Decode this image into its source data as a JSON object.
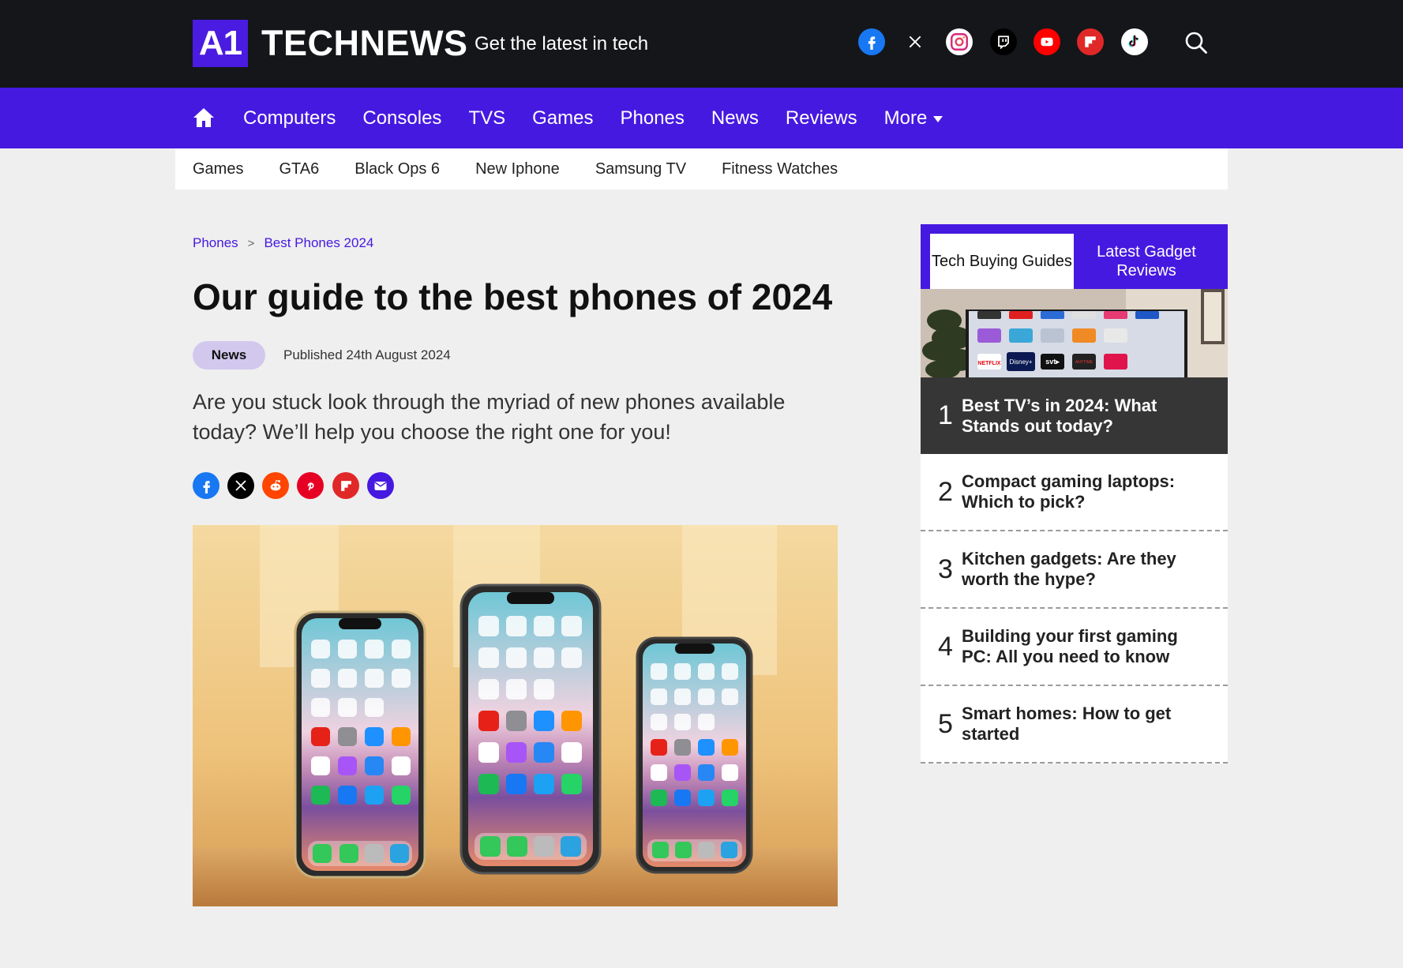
{
  "header": {
    "logo_mark": "A1",
    "logo_text": "TECHNEWS",
    "tagline": "Get the latest in tech",
    "social": [
      {
        "name": "facebook",
        "icon": "facebook-icon",
        "color": "#1877f2"
      },
      {
        "name": "x",
        "icon": "x-icon",
        "color": "#000000"
      },
      {
        "name": "instagram",
        "icon": "instagram-icon",
        "color": "#e4405f"
      },
      {
        "name": "twitch",
        "icon": "twitch-icon",
        "color": "#000000"
      },
      {
        "name": "youtube",
        "icon": "youtube-icon",
        "color": "#ff0000"
      },
      {
        "name": "flipboard",
        "icon": "flipboard-icon",
        "color": "#e12828"
      },
      {
        "name": "tiktok",
        "icon": "tiktok-icon",
        "color": "#000000"
      }
    ],
    "search_icon": "search-icon"
  },
  "nav": {
    "home_icon": "home-icon",
    "items": [
      "Computers",
      "Consoles",
      "TVS",
      "Games",
      "Phones",
      "News",
      "Reviews",
      "More"
    ],
    "accent": "#4619e0"
  },
  "subnav": {
    "items": [
      "Games",
      "GTA6",
      "Black Ops 6",
      "New Iphone",
      "Samsung TV",
      "Fitness Watches"
    ]
  },
  "article": {
    "breadcrumb": [
      "Phones",
      "Best Phones 2024"
    ],
    "breadcrumb_separator": ">",
    "title": "Our guide to the best phones of 2024",
    "category": "News",
    "published": "Published 24th August 2024",
    "standfirst": "Are you stuck look through the myriad of new phones available today? We’ll help you choose the right one for you!",
    "share": [
      {
        "name": "facebook",
        "icon": "facebook-icon",
        "color": "#1877f2"
      },
      {
        "name": "x",
        "icon": "x-icon",
        "color": "#000000"
      },
      {
        "name": "reddit",
        "icon": "reddit-icon",
        "color": "#ff4500"
      },
      {
        "name": "pinterest",
        "icon": "pinterest-icon",
        "color": "#e60023"
      },
      {
        "name": "flipboard",
        "icon": "flipboard-icon",
        "color": "#e12828"
      },
      {
        "name": "email",
        "icon": "email-icon",
        "color": "#4619e0"
      }
    ]
  },
  "sidebar": {
    "tabs": [
      "Tech Buying Guides",
      "Latest Gadget Reviews"
    ],
    "thumb_labels": [
      "NETFLIX",
      "Disney+",
      "svt▸",
      "ANYTIME"
    ],
    "items": [
      {
        "num": "1",
        "title": "Best TV’s in 2024: What Stands out today?"
      },
      {
        "num": "2",
        "title": "Compact gaming laptops: Which to pick?"
      },
      {
        "num": "3",
        "title": "Kitchen gadgets: Are they worth the hype?"
      },
      {
        "num": "4",
        "title": "Building your first gaming PC: All you need to know"
      },
      {
        "num": "5",
        "title": "Smart homes: How to get started"
      }
    ]
  }
}
